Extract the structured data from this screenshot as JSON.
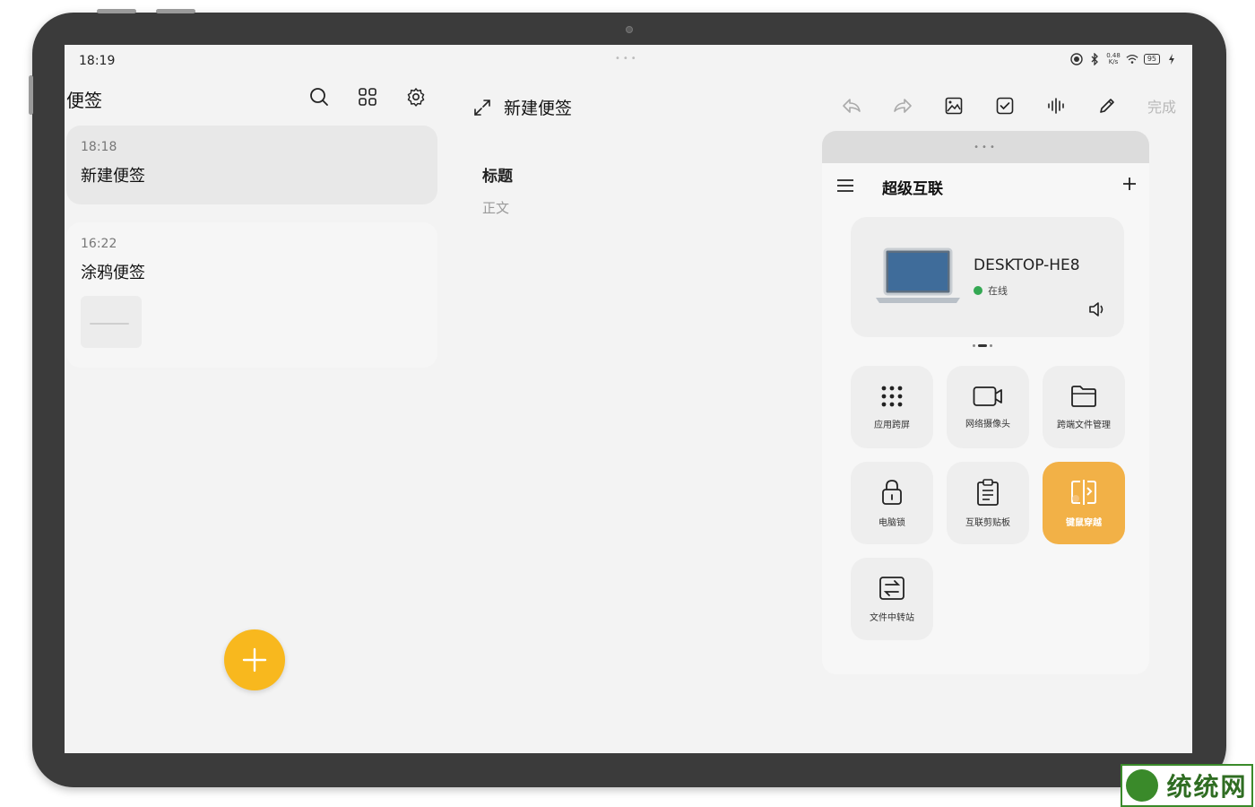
{
  "status_bar": {
    "time": "18:19",
    "speed_value": "0.48",
    "speed_unit": "K/s",
    "battery": "95"
  },
  "notes_list": {
    "title": "便签",
    "items": [
      {
        "time": "18:18",
        "title": "新建便签"
      },
      {
        "time": "16:22",
        "title": "涂鸦便签"
      }
    ]
  },
  "editor": {
    "header_title": "新建便签",
    "done_label": "完成",
    "doc_title_placeholder": "标题",
    "doc_body_placeholder": "正文"
  },
  "super_link": {
    "title": "超级互联",
    "device": {
      "name": "DESKTOP-HE8",
      "status": "在线"
    },
    "tiles": [
      {
        "label": "应用跨屏",
        "icon": "grid-dots-icon"
      },
      {
        "label": "网络摄像头",
        "icon": "video-camera-icon"
      },
      {
        "label": "跨端文件管理",
        "icon": "folder-icon"
      },
      {
        "label": "电脑锁",
        "icon": "lock-icon"
      },
      {
        "label": "互联剪贴板",
        "icon": "clipboard-icon"
      },
      {
        "label": "键鼠穿越",
        "icon": "mouse-keyboard-cross-icon"
      },
      {
        "label": "文件中转站",
        "icon": "file-transfer-icon"
      }
    ]
  },
  "watermark": {
    "text": "统统网"
  },
  "colors": {
    "accent": "#f8b81e",
    "active_tile": "#f2b147",
    "online": "#34a853"
  }
}
